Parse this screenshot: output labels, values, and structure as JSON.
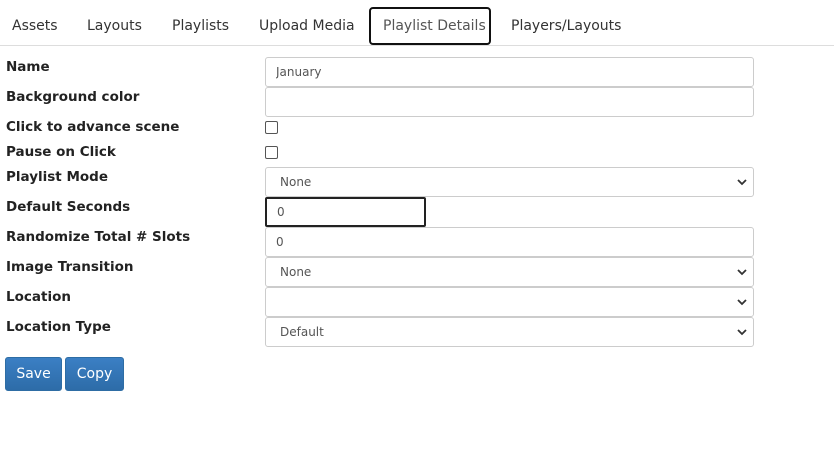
{
  "tabs": [
    {
      "label": "Assets"
    },
    {
      "label": "Layouts"
    },
    {
      "label": "Playlists"
    },
    {
      "label": "Upload Media"
    },
    {
      "label": "Playlist Details",
      "active": true
    },
    {
      "label": "Players/Layouts"
    }
  ],
  "form": {
    "name_label": "Name",
    "name_value": "January",
    "bgcolor_label": "Background color",
    "bgcolor_value": "",
    "click_advance_label": "Click to advance scene",
    "click_advance_checked": false,
    "pause_click_label": "Pause on Click",
    "pause_click_checked": false,
    "playlist_mode_label": "Playlist Mode",
    "playlist_mode_value": "None",
    "default_seconds_label": "Default Seconds",
    "default_seconds_value": "0",
    "randomize_label": "Randomize Total # Slots",
    "randomize_value": "0",
    "image_transition_label": "Image Transition",
    "image_transition_value": "None",
    "location_label": "Location",
    "location_value": "",
    "location_type_label": "Location Type",
    "location_type_value": "Default"
  },
  "actions": {
    "save_label": "Save",
    "copy_label": "Copy"
  },
  "colors": {
    "primary_button": "#337ab7",
    "active_tab_border": "#111111"
  }
}
